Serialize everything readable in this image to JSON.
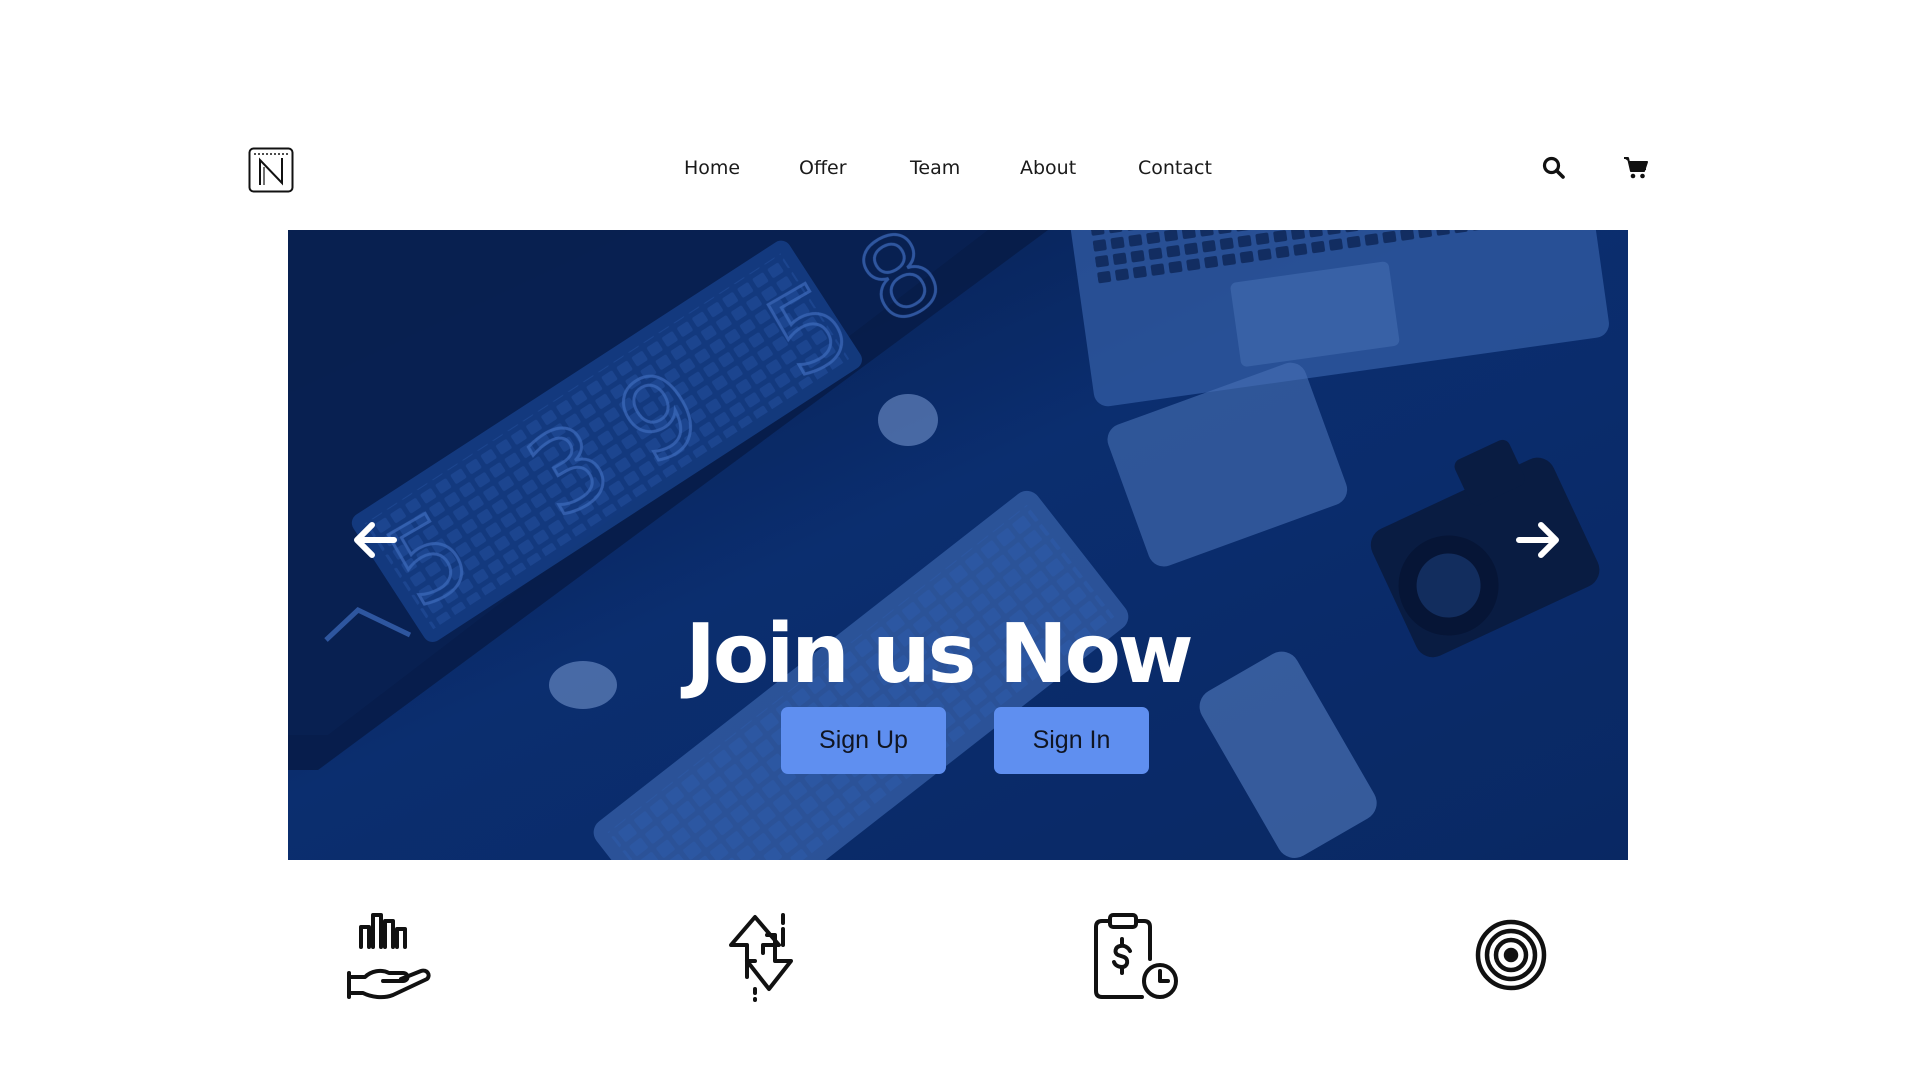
{
  "brand": {
    "logo_icon": "n-logo-icon"
  },
  "nav": {
    "items": [
      {
        "label": "Home"
      },
      {
        "label": "Offer"
      },
      {
        "label": "Team"
      },
      {
        "label": "About"
      },
      {
        "label": "Contact"
      }
    ]
  },
  "header_actions": {
    "search_icon": "search-icon",
    "cart_icon": "cart-icon"
  },
  "hero": {
    "title": "Join us Now",
    "buttons": {
      "sign_up": "Sign Up",
      "sign_in": "Sign In"
    },
    "prev_icon": "arrow-left-icon",
    "next_icon": "arrow-right-icon",
    "overlay_color": "#0c2f6e",
    "button_color": "#5f8ff0"
  },
  "features": {
    "icons": [
      "hand-bar-chart-icon",
      "up-down-arrows-icon",
      "clipboard-dollar-clock-icon",
      "target-icon"
    ]
  }
}
